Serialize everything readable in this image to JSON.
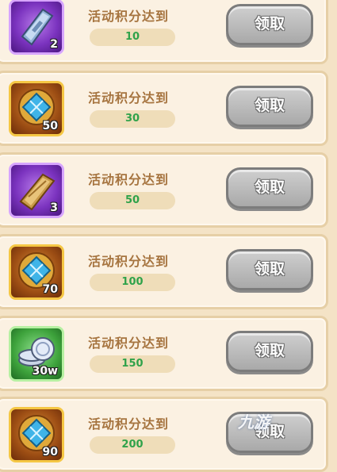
{
  "rows": [
    {
      "label": "活动积分达到",
      "points": "10",
      "qty": "2",
      "button": "领取",
      "item_icon": "silver-ingot-icon",
      "frame": "purple"
    },
    {
      "label": "活动积分达到",
      "points": "30",
      "qty": "50",
      "button": "领取",
      "item_icon": "blue-gem-medallion-icon",
      "frame": "gold"
    },
    {
      "label": "活动积分达到",
      "points": "50",
      "qty": "3",
      "button": "领取",
      "item_icon": "gold-ingot-icon",
      "frame": "purple"
    },
    {
      "label": "活动积分达到",
      "points": "100",
      "qty": "70",
      "button": "领取",
      "item_icon": "blue-gem-medallion-icon",
      "frame": "gold"
    },
    {
      "label": "活动积分达到",
      "points": "150",
      "qty": "30w",
      "button": "领取",
      "item_icon": "silver-coins-icon",
      "frame": "green"
    },
    {
      "label": "活动积分达到",
      "points": "200",
      "qty": "90",
      "button": "领取",
      "item_icon": "blue-gem-medallion-icon",
      "frame": "gold"
    }
  ],
  "watermark": "九游",
  "colors": {
    "label": "#a6743f",
    "points": "#2fa24a",
    "button_bg": "#b9b9b9",
    "panel": "#fbf1e2",
    "border": "#e6cfa6"
  }
}
